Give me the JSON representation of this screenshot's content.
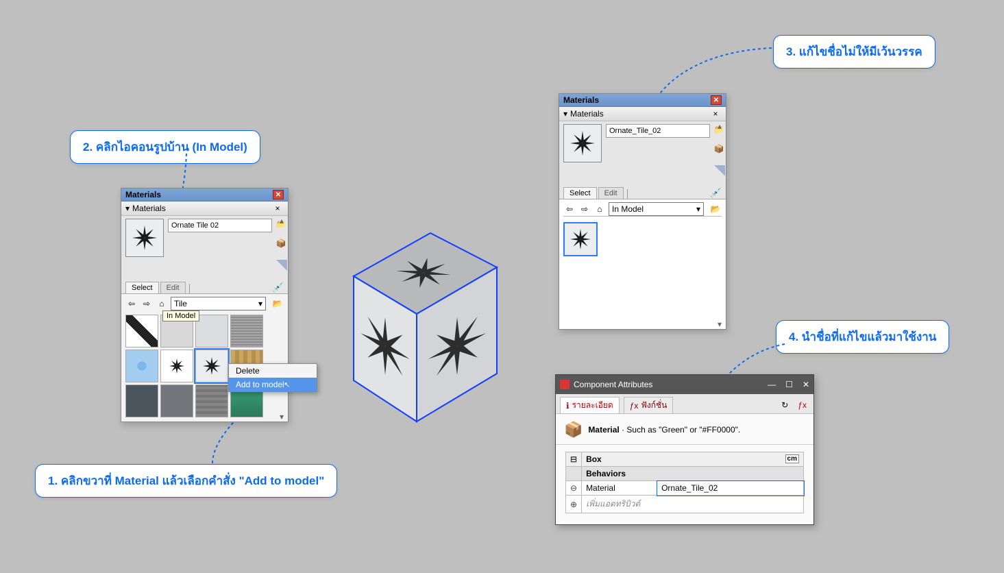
{
  "callouts": {
    "c1": "1. คลิกขวาที่ Material แล้วเลือกคำสั่ง \"Add to model\"",
    "c2": "2. คลิกไอคอนรูปบ้าน (In Model)",
    "c3": "3. แก้ไขชื่อไม่ให้มีเว้นวรรค",
    "c4": "4. นำชื่อที่แก้ไขแล้วมาใช้งาน"
  },
  "materials": {
    "title": "Materials",
    "subtitle": "Materials",
    "name1": "Ornate Tile 02",
    "name2": "Ornate_Tile_02",
    "tab_select": "Select",
    "tab_edit": "Edit",
    "drop_tile": "Tile",
    "drop_inmodel": "In Model",
    "tooltip_inmodel": "In Model",
    "context_delete": "Delete",
    "context_add": "Add to model"
  },
  "attributes": {
    "title": "Component Attributes",
    "tab_detail": "รายละเอียด",
    "tab_func": "ฟังก์ชั่น",
    "hint_label": "Material",
    "hint_rest": " · Such as \"Green\" or \"#FF0000\".",
    "head": "Box",
    "unit": "cm",
    "behaviors": "Behaviors",
    "row_material": "Material",
    "row_value": "Ornate_Tile_02",
    "row_add": "เพิ่มแอตทริบิวต์"
  }
}
